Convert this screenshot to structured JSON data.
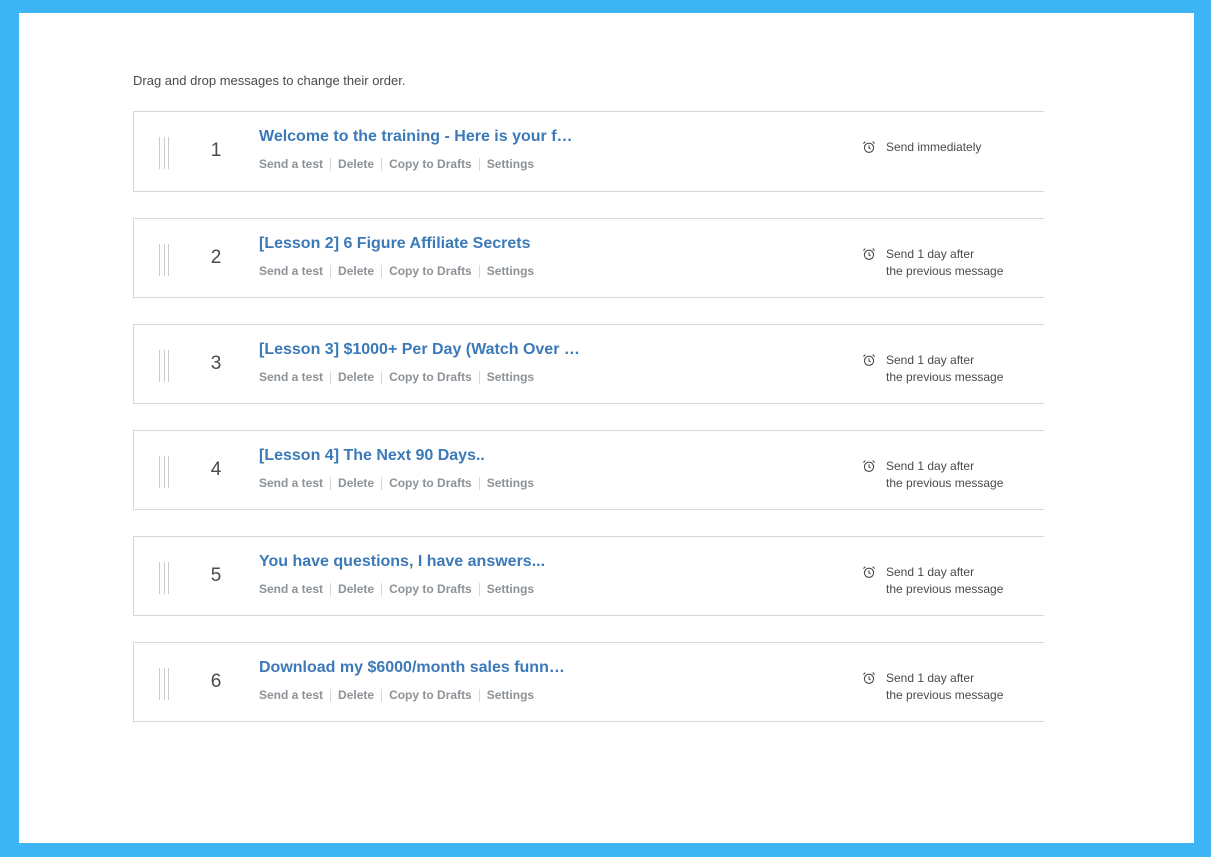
{
  "instructions": "Drag and drop messages to change their order.",
  "actions": {
    "send_test": "Send a test",
    "delete": "Delete",
    "copy_to_drafts": "Copy to Drafts",
    "settings": "Settings"
  },
  "messages": [
    {
      "number": "1",
      "title": "Welcome to the training - Here is your f…",
      "schedule_line1": "Send immediately",
      "schedule_line2": ""
    },
    {
      "number": "2",
      "title": "[Lesson 2] 6 Figure Affiliate Secrets",
      "schedule_line1": "Send 1 day after",
      "schedule_line2": "the previous message"
    },
    {
      "number": "3",
      "title": "[Lesson 3] $1000+ Per Day (Watch Over …",
      "schedule_line1": "Send 1 day after",
      "schedule_line2": "the previous message"
    },
    {
      "number": "4",
      "title": "[Lesson 4] The Next 90 Days..",
      "schedule_line1": "Send 1 day after",
      "schedule_line2": "the previous message"
    },
    {
      "number": "5",
      "title": "You have questions, I have answers...",
      "schedule_line1": "Send 1 day after",
      "schedule_line2": "the previous message"
    },
    {
      "number": "6",
      "title": "Download my $6000/month sales funn…",
      "schedule_line1": "Send 1 day after",
      "schedule_line2": "the previous message"
    }
  ],
  "colors": {
    "frame": "#3db5f5",
    "title_link": "#3b79b9",
    "action_text": "#8c9297",
    "border": "#d6d9dc"
  },
  "icons": {
    "schedule": "alarm-clock-icon",
    "drag": "drag-handle-icon"
  }
}
